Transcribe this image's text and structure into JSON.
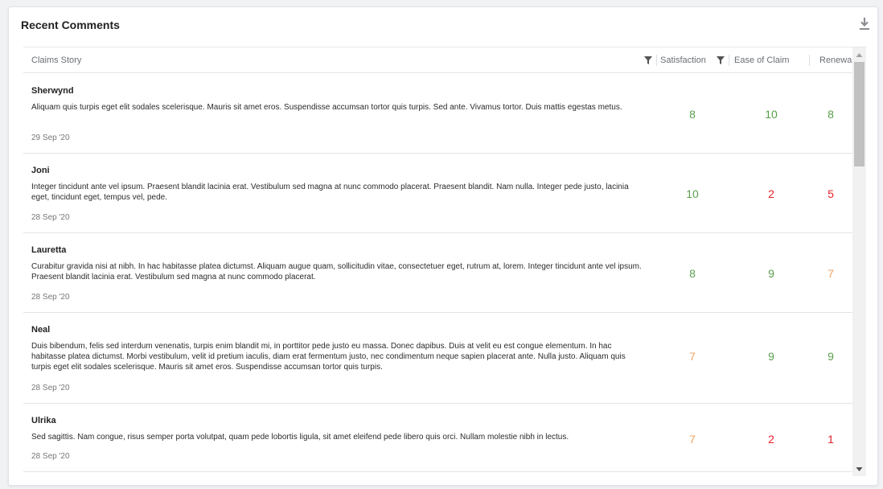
{
  "widget": {
    "title": "Recent Comments",
    "download_icon": "download-icon"
  },
  "columns": {
    "story": "Claims Story",
    "satisfaction": "Satisfaction",
    "ease": "Ease of Claim",
    "renewal": "Renewal"
  },
  "colors": {
    "high": "#5a9e4b",
    "mid": "#f0a261",
    "low": "#e8222a"
  },
  "rows": [
    {
      "name": "Sherwynd",
      "text": "Aliquam quis turpis eget elit sodales scelerisque. Mauris sit amet eros. Suspendisse accumsan tortor quis turpis. Sed ante. Vivamus tortor. Duis mattis egestas metus.",
      "date": "29 Sep '20",
      "satisfaction": "8",
      "ease": "10",
      "renewal": "8"
    },
    {
      "name": "Joni",
      "text": "Integer tincidunt ante vel ipsum. Praesent blandit lacinia erat. Vestibulum sed magna at nunc commodo placerat. Praesent blandit. Nam nulla. Integer pede justo, lacinia eget, tincidunt eget, tempus vel, pede.",
      "date": "28 Sep '20",
      "satisfaction": "10",
      "ease": "2",
      "renewal": "5"
    },
    {
      "name": "Lauretta",
      "text": "Curabitur gravida nisi at nibh. In hac habitasse platea dictumst. Aliquam augue quam, sollicitudin vitae, consectetuer eget, rutrum at, lorem. Integer tincidunt ante vel ipsum. Praesent blandit lacinia erat. Vestibulum sed magna at nunc commodo placerat.",
      "date": "28 Sep '20",
      "satisfaction": "8",
      "ease": "9",
      "renewal": "7"
    },
    {
      "name": "Neal",
      "text": "Duis bibendum, felis sed interdum venenatis, turpis enim blandit mi, in porttitor pede justo eu massa. Donec dapibus. Duis at velit eu est congue elementum. In hac habitasse platea dictumst. Morbi vestibulum, velit id pretium iaculis, diam erat fermentum justo, nec condimentum neque sapien placerat ante. Nulla justo. Aliquam quis turpis eget elit sodales scelerisque. Mauris sit amet eros. Suspendisse accumsan tortor quis turpis.",
      "date": "28 Sep '20",
      "satisfaction": "7",
      "ease": "9",
      "renewal": "9"
    },
    {
      "name": "Ulrika",
      "text": "Sed sagittis. Nam congue, risus semper porta volutpat, quam pede lobortis ligula, sit amet eleifend pede libero quis orci. Nullam molestie nibh in lectus.",
      "date": "28 Sep '20",
      "satisfaction": "7",
      "ease": "2",
      "renewal": "1"
    }
  ]
}
